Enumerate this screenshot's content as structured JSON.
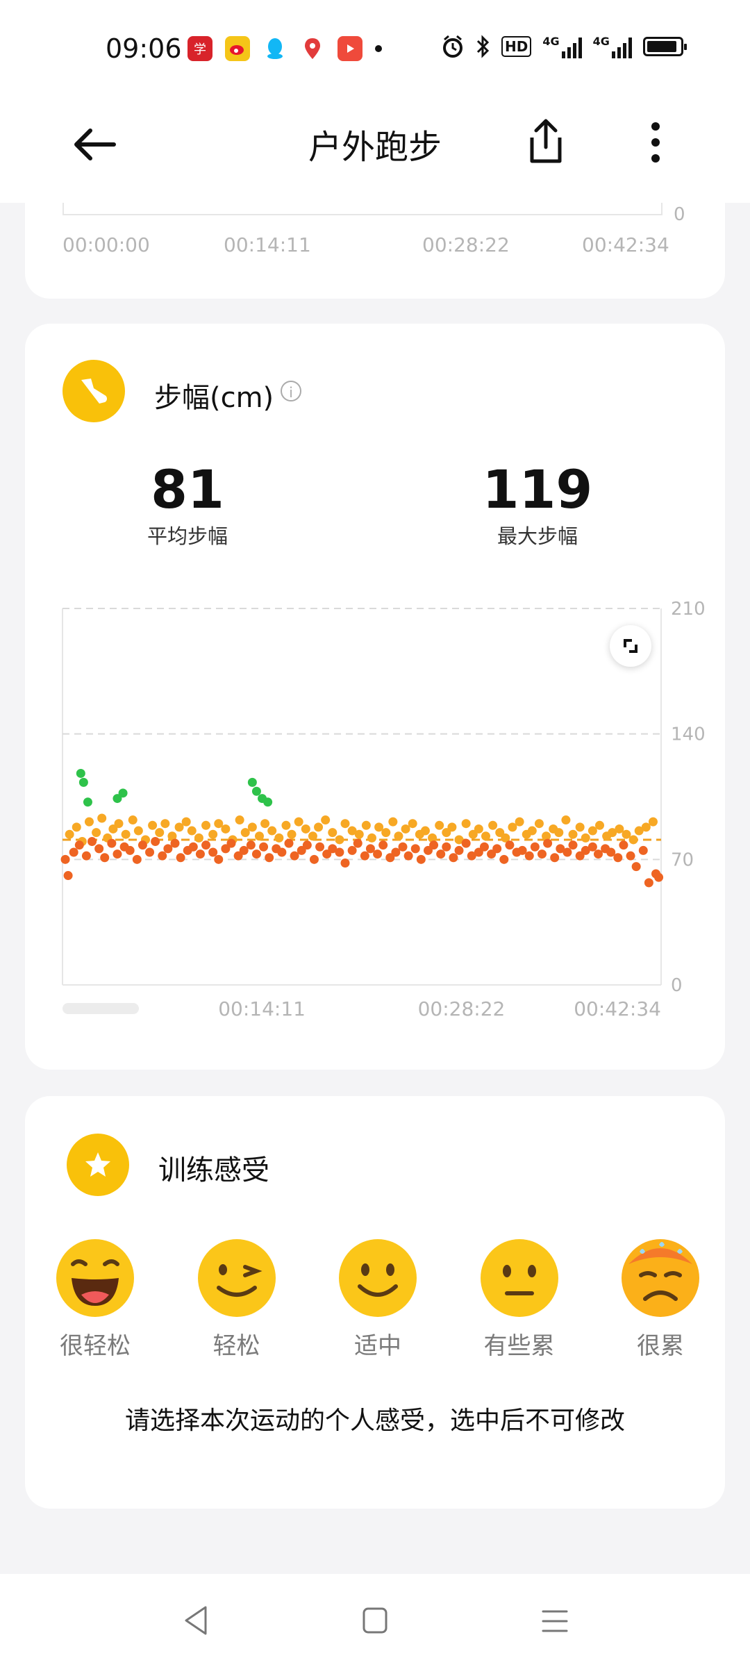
{
  "status_bar": {
    "time": "09:06",
    "network_1": "4G",
    "network_2": "4G",
    "hd_badge": "HD",
    "battery_level": 0.92,
    "app_icons": [
      "xuexi-icon",
      "weibo-icon",
      "qq-icon",
      "map-pin-icon",
      "video-icon"
    ]
  },
  "header": {
    "title": "户外跑步"
  },
  "prev_chart": {
    "x_ticks": [
      "00:00:00",
      "00:14:11",
      "00:28:22",
      "00:42:34"
    ],
    "y_bottom": "0"
  },
  "stride_card": {
    "title": "步幅(cm)",
    "avg_value": "81",
    "avg_label": "平均步幅",
    "max_value": "119",
    "max_label": "最大步幅"
  },
  "chart_data": {
    "type": "scatter",
    "title": "步幅(cm)",
    "x_ticks": [
      "00:14:11",
      "00:28:22",
      "00:42:34"
    ],
    "y_ticks": [
      "210",
      "140",
      "70",
      "0"
    ],
    "ylim": [
      0,
      210
    ],
    "average_line": 81,
    "x_range_minutes": [
      0,
      42.57
    ],
    "colors": {
      "green": "#2ec24a",
      "yellow": "#f7a824",
      "orange": "#ee6422",
      "avg_line": "#f0a020",
      "grid": "#d9d9d9"
    },
    "series": [
      {
        "color_key": "green",
        "x": [
          1.3,
          1.5,
          1.8,
          3.9,
          4.3,
          13.5,
          13.8,
          14.2,
          14.6
        ],
        "y": [
          118,
          113,
          102,
          104,
          107,
          113,
          108,
          104,
          102
        ]
      },
      {
        "color_key": "yellow",
        "x": [
          0.5,
          1.0,
          1.4,
          1.9,
          2.4,
          2.8,
          3.2,
          3.6,
          4.0,
          4.5,
          5.0,
          5.4,
          5.9,
          6.4,
          6.9,
          7.3,
          7.8,
          8.3,
          8.8,
          9.2,
          9.7,
          10.2,
          10.7,
          11.1,
          11.6,
          12.1,
          12.6,
          13.0,
          13.5,
          14.0,
          14.4,
          14.9,
          15.4,
          15.9,
          16.3,
          16.8,
          17.3,
          17.8,
          18.2,
          18.7,
          19.2,
          19.7,
          20.1,
          20.6,
          21.1,
          21.6,
          22.0,
          22.5,
          23.0,
          23.5,
          23.9,
          24.4,
          24.9,
          25.4,
          25.8,
          26.3,
          26.8,
          27.3,
          27.7,
          28.2,
          28.7,
          29.2,
          29.6,
          30.1,
          30.6,
          31.1,
          31.5,
          32.0,
          32.5,
          33.0,
          33.4,
          33.9,
          34.4,
          34.9,
          35.3,
          35.8,
          36.3,
          36.8,
          37.2,
          37.7,
          38.2,
          38.7,
          39.1,
          39.6,
          40.1,
          40.6,
          41.0,
          41.5,
          42.0
        ],
        "y": [
          84,
          88,
          80,
          91,
          85,
          93,
          82,
          87,
          90,
          84,
          92,
          86,
          81,
          89,
          85,
          90,
          83,
          88,
          91,
          86,
          82,
          89,
          84,
          90,
          87,
          81,
          92,
          85,
          88,
          83,
          90,
          86,
          82,
          89,
          84,
          91,
          87,
          83,
          88,
          92,
          85,
          81,
          90,
          86,
          84,
          89,
          82,
          88,
          85,
          91,
          83,
          87,
          90,
          84,
          86,
          82,
          89,
          85,
          88,
          81,
          90,
          84,
          87,
          83,
          89,
          85,
          82,
          88,
          91,
          84,
          86,
          90,
          83,
          87,
          85,
          92,
          84,
          88,
          82,
          86,
          89,
          83,
          85,
          87,
          84,
          81,
          86,
          88,
          91
        ]
      },
      {
        "color_key": "orange",
        "x": [
          0.2,
          0.4,
          0.8,
          1.2,
          1.7,
          2.1,
          2.6,
          3.0,
          3.5,
          3.9,
          4.4,
          4.8,
          5.3,
          5.7,
          6.2,
          6.6,
          7.1,
          7.5,
          8.0,
          8.4,
          8.9,
          9.3,
          9.8,
          10.2,
          10.7,
          11.1,
          11.6,
          12.0,
          12.5,
          12.9,
          13.4,
          13.8,
          14.3,
          14.7,
          15.2,
          15.6,
          16.1,
          16.5,
          17.0,
          17.4,
          17.9,
          18.3,
          18.8,
          19.2,
          19.7,
          20.1,
          20.6,
          21.0,
          21.5,
          21.9,
          22.4,
          22.8,
          23.3,
          23.7,
          24.2,
          24.6,
          25.1,
          25.5,
          26.0,
          26.4,
          26.9,
          27.3,
          27.8,
          28.2,
          28.7,
          29.1,
          29.6,
          30.0,
          30.5,
          30.9,
          31.4,
          31.8,
          32.3,
          32.7,
          33.2,
          33.6,
          34.1,
          34.5,
          35.0,
          35.4,
          35.9,
          36.3,
          36.8,
          37.2,
          37.7,
          38.1,
          38.6,
          39.0,
          39.5,
          39.9,
          40.4,
          40.8,
          41.3,
          41.7,
          42.2,
          42.4
        ],
        "y": [
          70,
          61,
          74,
          78,
          72,
          80,
          76,
          71,
          79,
          73,
          77,
          75,
          70,
          78,
          74,
          80,
          72,
          76,
          79,
          71,
          75,
          77,
          73,
          78,
          74,
          70,
          76,
          79,
          72,
          75,
          78,
          73,
          77,
          71,
          76,
          74,
          79,
          72,
          75,
          78,
          70,
          77,
          73,
          76,
          74,
          68,
          75,
          79,
          72,
          76,
          73,
          78,
          71,
          74,
          77,
          72,
          76,
          70,
          75,
          78,
          73,
          77,
          71,
          75,
          79,
          72,
          74,
          77,
          73,
          76,
          70,
          78,
          74,
          75,
          72,
          77,
          73,
          79,
          71,
          76,
          74,
          78,
          72,
          75,
          77,
          73,
          76,
          74,
          71,
          78,
          72,
          66,
          75,
          57,
          62,
          60
        ]
      }
    ]
  },
  "feeling_card": {
    "title": "训练感受",
    "options": [
      {
        "label": "很轻松",
        "icon": "grinning-face-icon"
      },
      {
        "label": "轻松",
        "icon": "winking-face-icon"
      },
      {
        "label": "适中",
        "icon": "smiling-face-icon"
      },
      {
        "label": "有些累",
        "icon": "neutral-face-icon"
      },
      {
        "label": "很累",
        "icon": "sweating-face-icon"
      }
    ],
    "hint": "请选择本次运动的个人感受，选中后不可修改"
  }
}
